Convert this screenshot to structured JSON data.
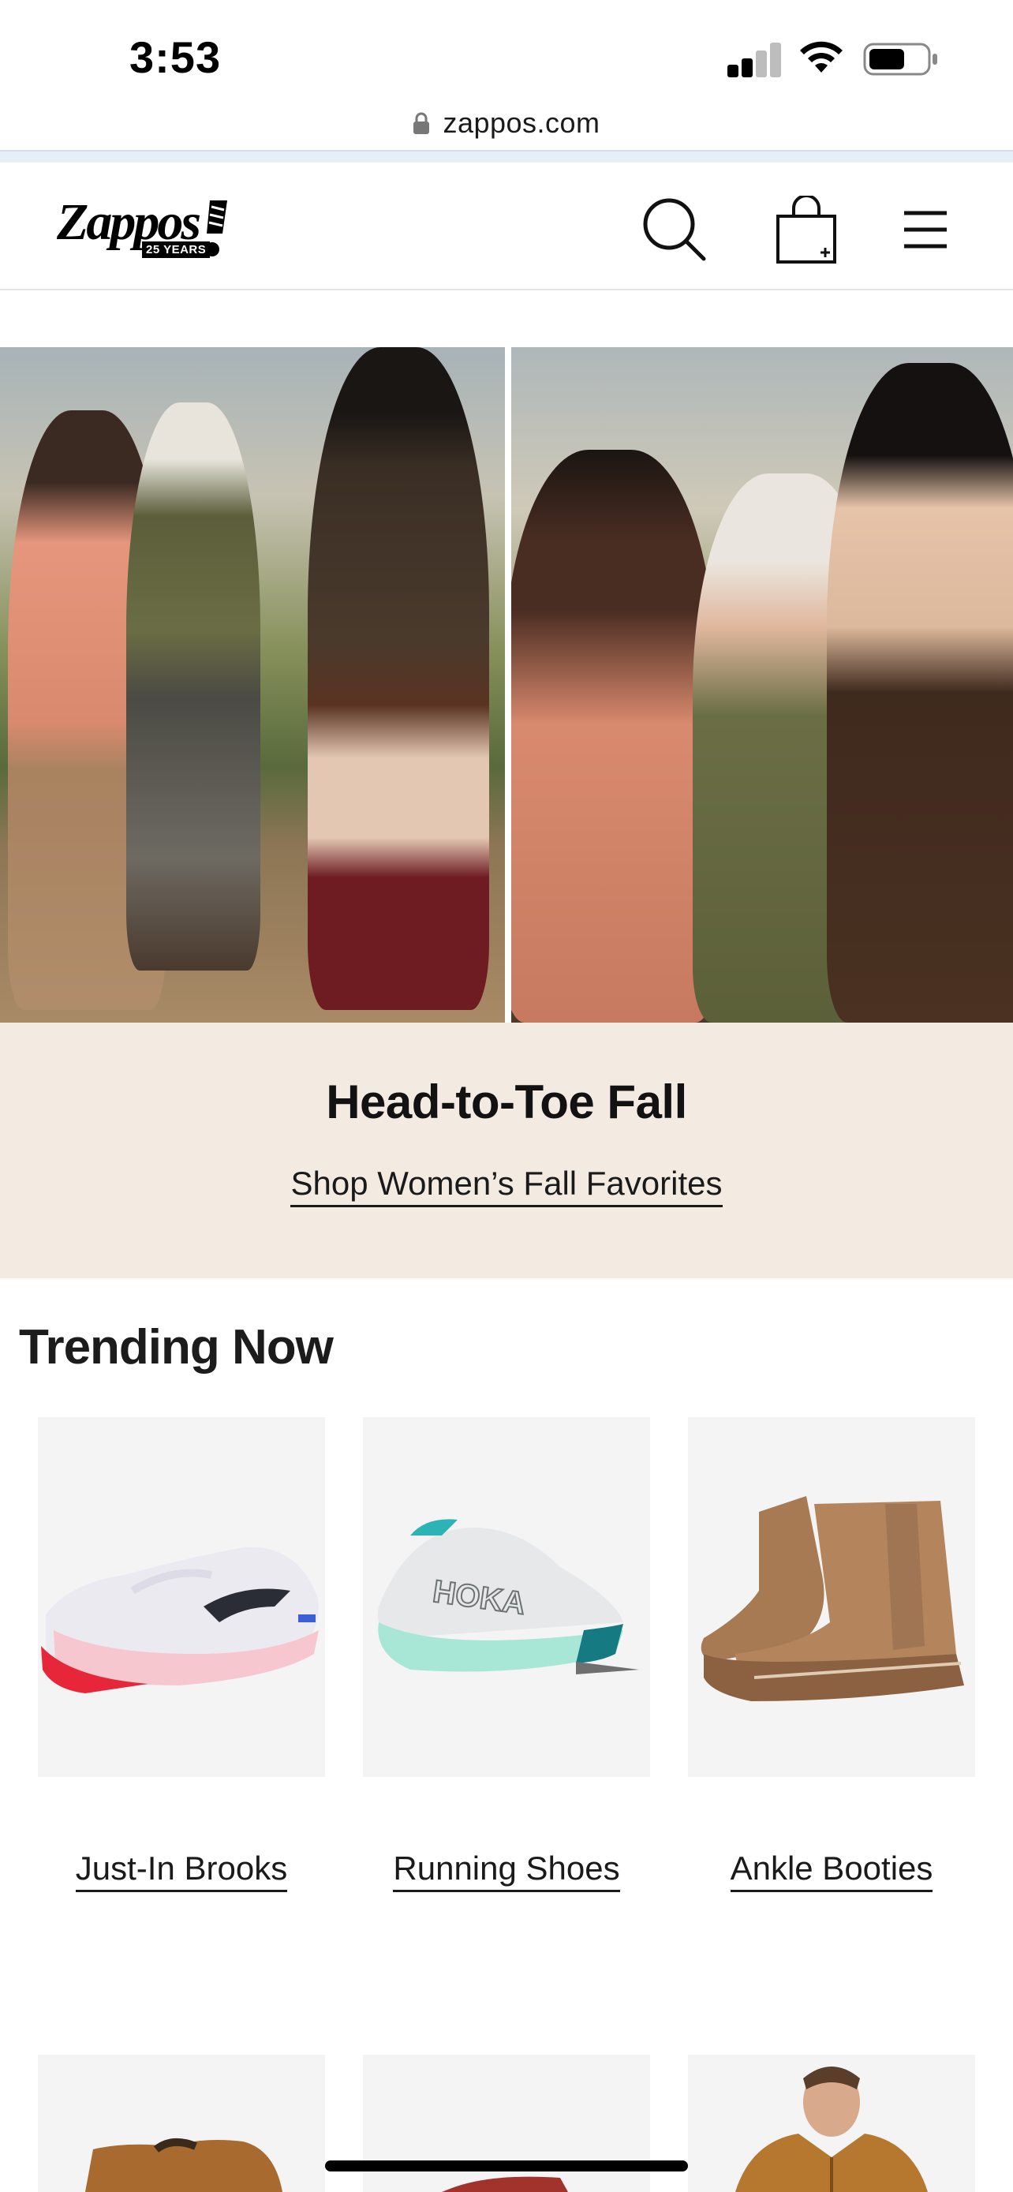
{
  "status_bar": {
    "time": "3:53"
  },
  "browser": {
    "url": "zappos.com"
  },
  "header": {
    "logo_text": "Zappos",
    "logo_badge": "25 YEARS"
  },
  "hero": {
    "title": "Head-to-Toe Fall",
    "link": "Shop Women’s Fall Favorites"
  },
  "trending": {
    "title": "Trending Now",
    "items": [
      {
        "label": "Just-In Brooks"
      },
      {
        "label": "Running Shoes"
      },
      {
        "label": "Ankle Booties"
      }
    ]
  },
  "colors": {
    "promo_bg": "#f3ebe2",
    "card_bg": "#f4f4f4",
    "text": "#1a1a1a"
  }
}
